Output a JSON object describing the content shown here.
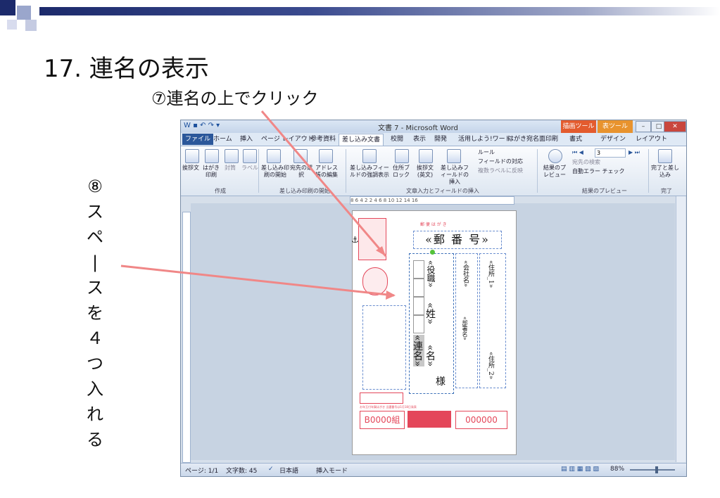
{
  "slide": {
    "title": "17. 連名の表示",
    "callout_click": "⑦連名の上でクリック",
    "callout_space_chars": [
      "⑧",
      "ス",
      "ペ",
      "|",
      "ス",
      "を",
      "４",
      "つ",
      "入",
      "れ",
      "る"
    ]
  },
  "window": {
    "doc_title": "文書 7 - Microsoft Word",
    "context_tab_drawing": "描画ツール",
    "context_tab_table": "表ツール",
    "tabs": [
      "ファイル",
      "ホーム",
      "挿入",
      "ページ レイアウト",
      "参考資料",
      "差し込み文書",
      "校閲",
      "表示",
      "開発",
      "活用しよう!ワード",
      "はがき宛名面印刷",
      "書式",
      "デザイン",
      "レイアウト"
    ],
    "ribbon": {
      "group_create": "作成",
      "group_start": "差し込み印刷の開始",
      "group_insert": "文章入力とフィールドの挿入",
      "group_preview": "結果のプレビュー",
      "group_finish": "完了",
      "btn_greeting": "挨拶文",
      "btn_postcard": "はがき印刷",
      "btn_envelope": "封筒",
      "btn_label": "ラベル",
      "btn_start_merge": "差し込み印刷の開始",
      "btn_select_recipients": "宛先の選択",
      "btn_edit_list": "アドレス帳の編集",
      "btn_highlight_fields": "差し込みフィールドの強調表示",
      "btn_address_block": "住所ブロック",
      "btn_greeting_line": "挨拶文(英文)",
      "btn_insert_field": "差し込みフィールドの挿入",
      "btn_rules": "ルール",
      "btn_match_fields": "フィールドの対応",
      "btn_update_labels": "複数ラベルに反映",
      "btn_preview": "結果のプレビュー",
      "record_number": "3",
      "btn_find_recipient": "宛先の検索",
      "btn_auto_check": "自動エラー チェック",
      "btn_finish": "完了と差し込み"
    },
    "ruler_text": "8   6   4   2   2   4   6  8  10  12  14  16",
    "status": {
      "page": "ページ: 1/1",
      "words": "文字数: 45",
      "language": "日本語",
      "mode": "挿入モード",
      "zoom": "88%"
    }
  },
  "postcard": {
    "header_label": "郵 便 は が き",
    "postal": "«郵 番 号»",
    "yakushoku": "«役職»",
    "sei": "«姓»",
    "rename": "«連名»",
    "mei": "«名»",
    "sama": "様",
    "company": "«会社名»",
    "dept": "«部署名»",
    "address1": "«住所_1»",
    "address2": "«住所_2»",
    "lottery_group": "B0000組",
    "lottery_number": "000000",
    "fine_print": "お年玉付年賀はがき 当選番号は1月18日発表"
  }
}
